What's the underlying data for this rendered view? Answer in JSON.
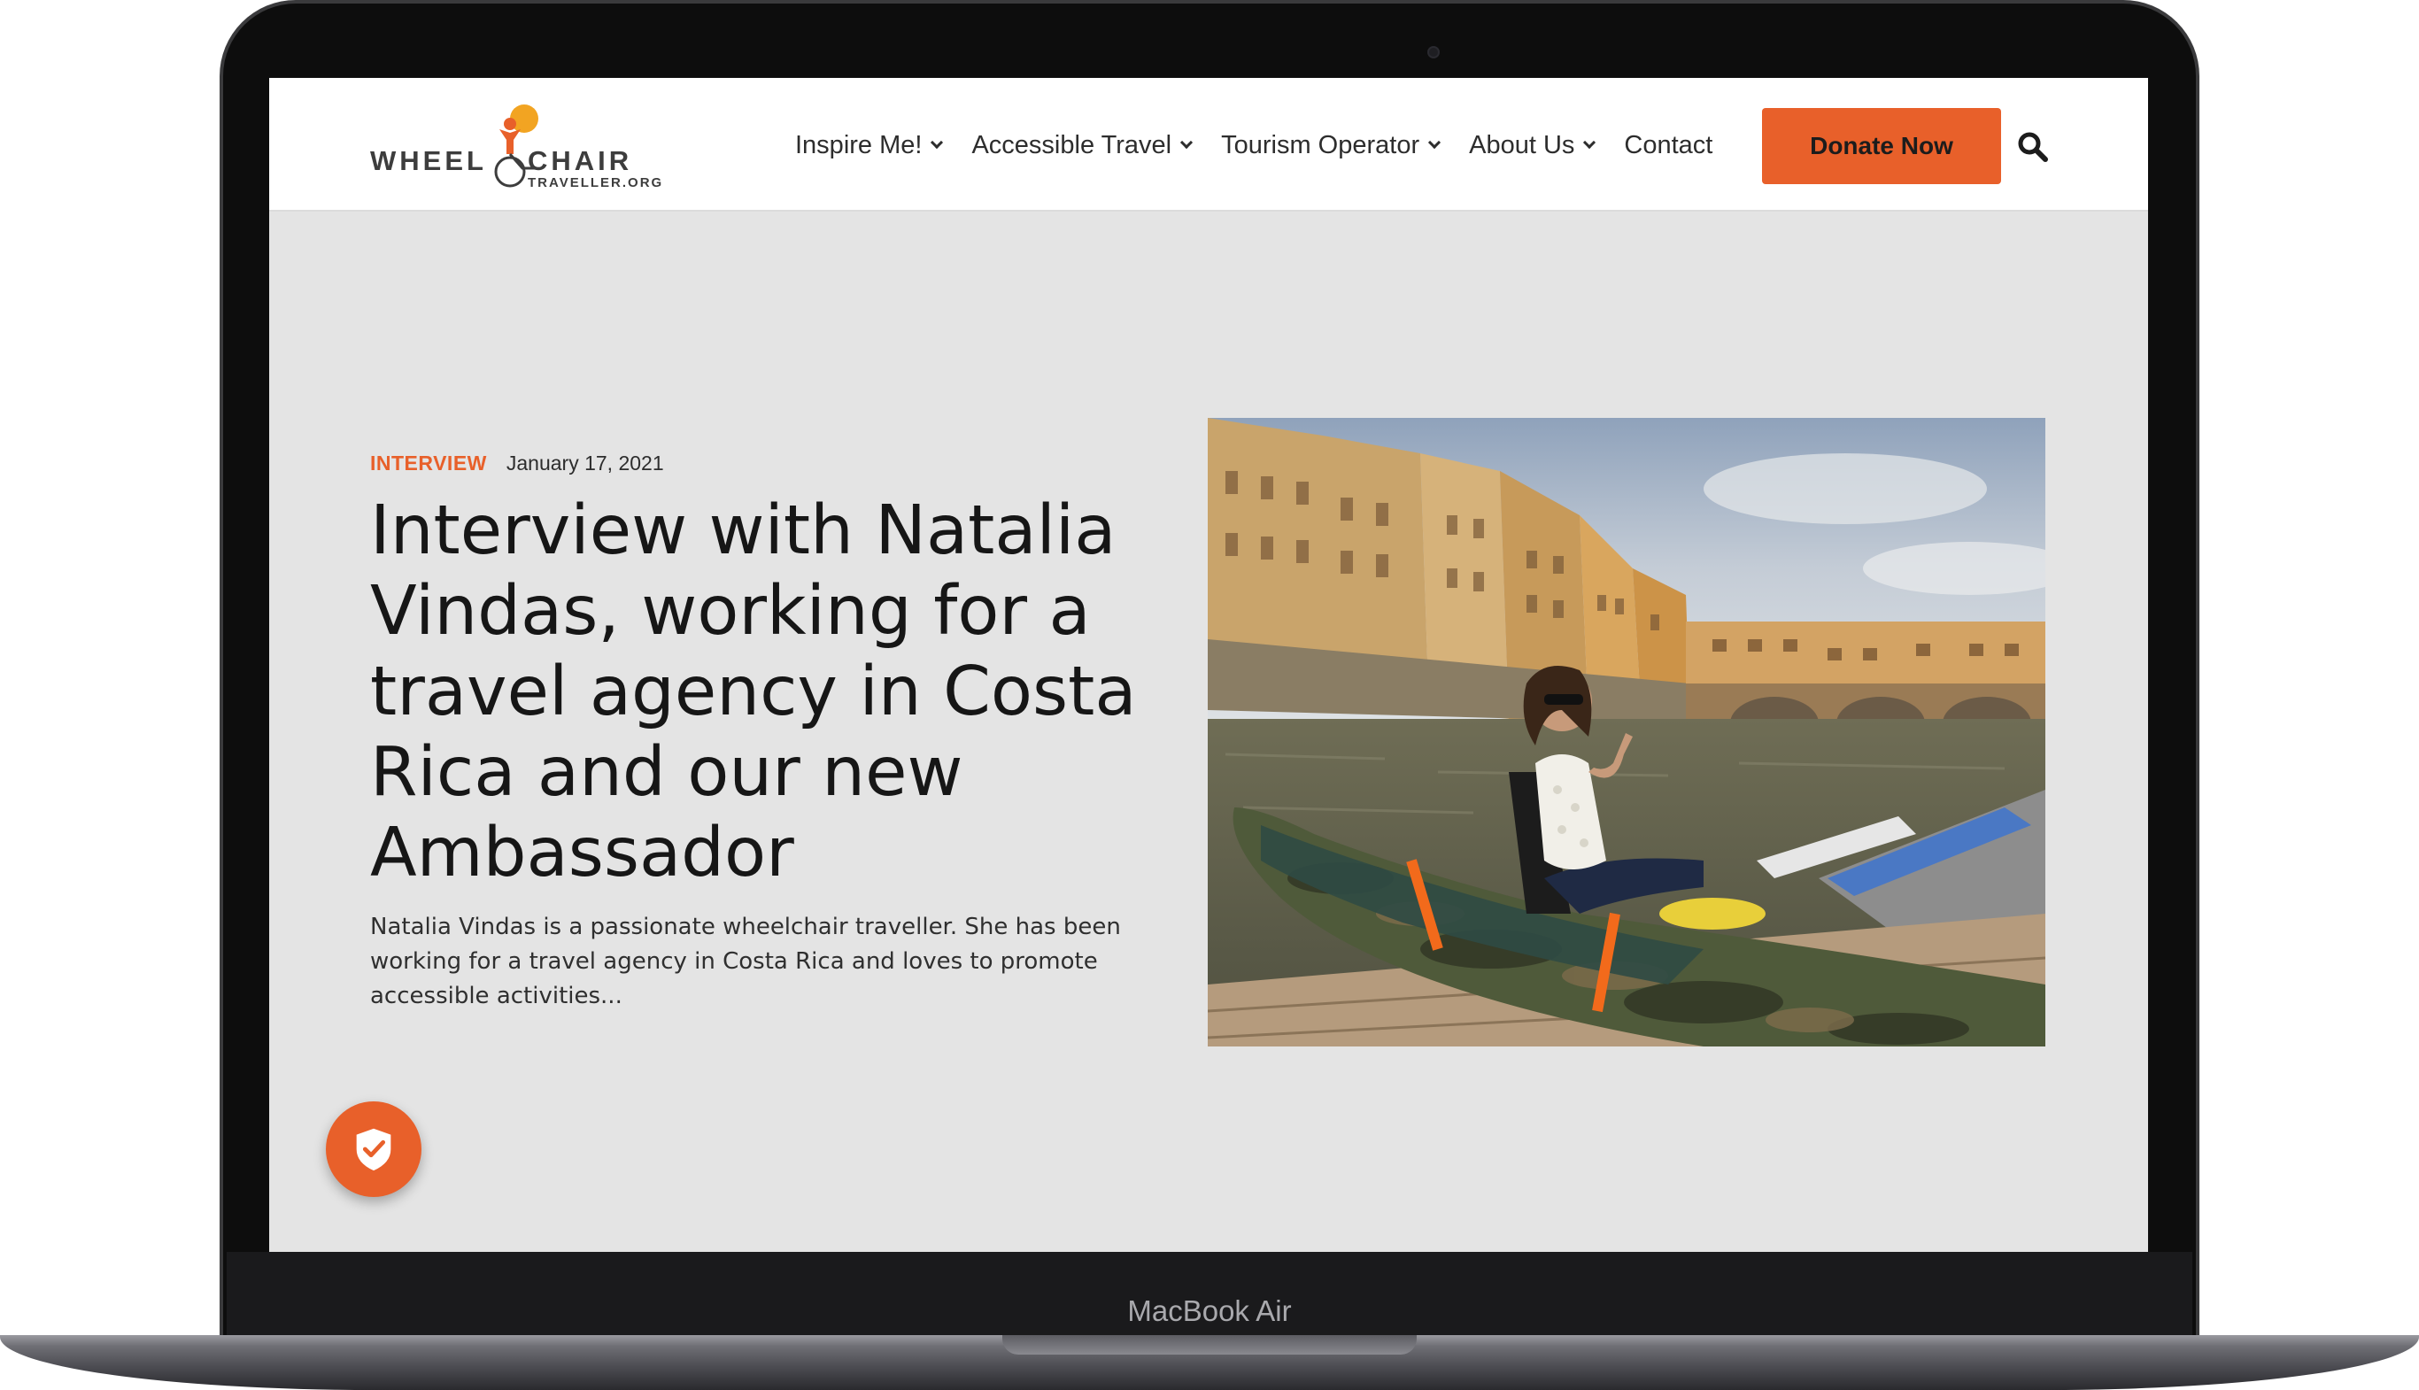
{
  "device": {
    "label": "MacBook Air"
  },
  "header": {
    "logo": {
      "word_left": "WHEEL",
      "word_right": "CHAIR",
      "domain": "TRAVELLER.ORG"
    },
    "nav": [
      {
        "label": "Inspire Me!",
        "has_dropdown": true
      },
      {
        "label": "Accessible Travel",
        "has_dropdown": true
      },
      {
        "label": "Tourism Operator",
        "has_dropdown": true
      },
      {
        "label": "About Us",
        "has_dropdown": true
      },
      {
        "label": "Contact",
        "has_dropdown": false
      }
    ],
    "donate_label": "Donate Now",
    "search_icon": "search-icon"
  },
  "post": {
    "category": "INTERVIEW",
    "date": "January 17, 2021",
    "title": "Interview with Natalia Vindas, working for a travel agency in Costa Rica and our new Ambassador",
    "excerpt": "Natalia Vindas is a passionate wheelchair traveller. She has been working for a travel agency in Costa Rica and loves to promote accessible activities..."
  },
  "floating_badge": {
    "icon": "shield-check-icon"
  },
  "colors": {
    "accent": "#e8602a",
    "page_background": "#e4e4e4",
    "header_background": "#ffffff",
    "title_text": "#161616"
  }
}
